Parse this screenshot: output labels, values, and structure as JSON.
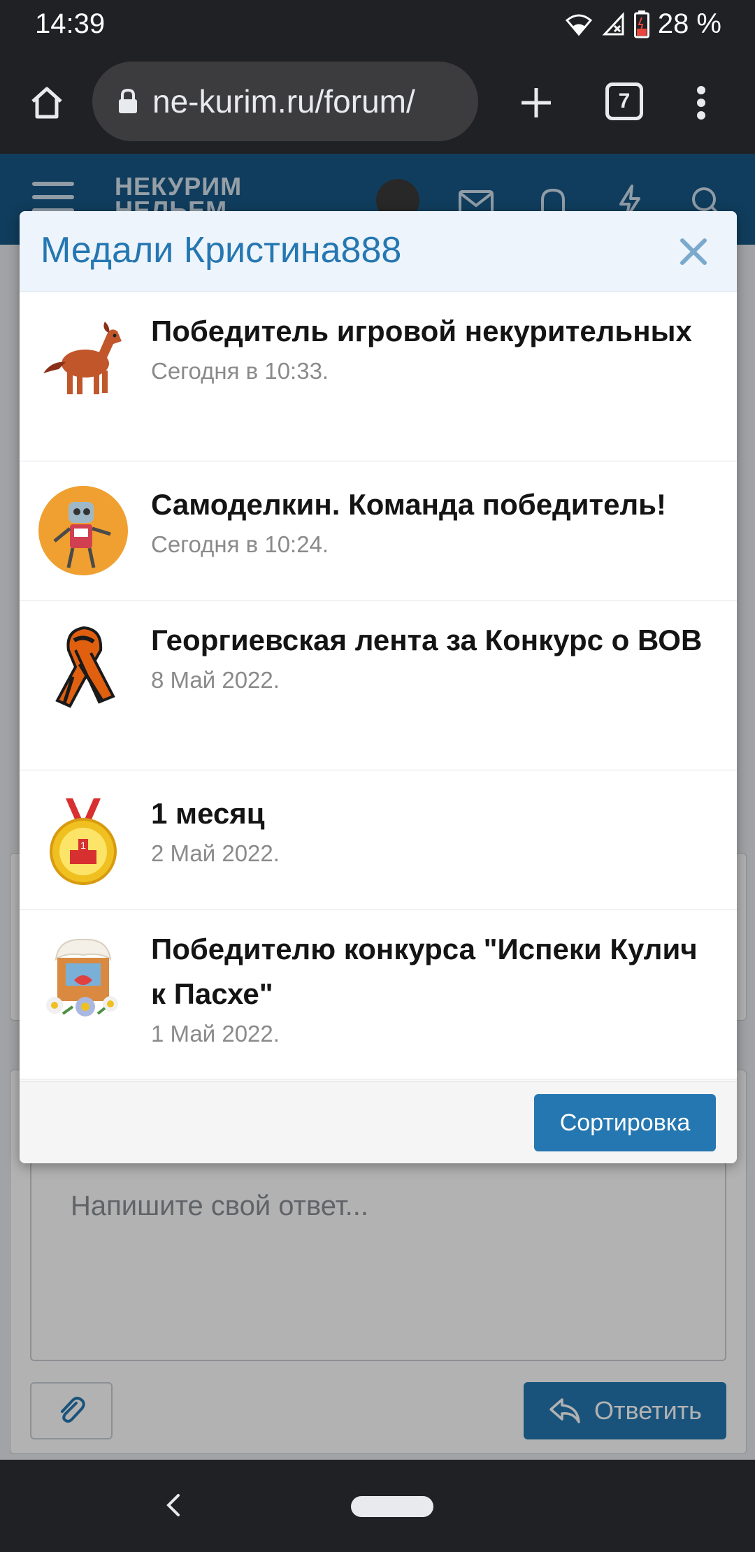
{
  "status_bar": {
    "time": "14:39",
    "battery": "28 %",
    "icons": [
      "wifi-icon",
      "signal-icon",
      "battery-icon"
    ]
  },
  "browser": {
    "url": "ne-kurim.ru/forum/",
    "tab_count": "7",
    "icons": [
      "home-icon",
      "lock-icon",
      "plus-icon",
      "more-vert-icon"
    ]
  },
  "site": {
    "logo": "НЕКУРИМ\nНЕЛЕМ",
    "header_icons": [
      "menu-icon",
      "avatar",
      "mail-icon",
      "bell-icon",
      "bolt-icon",
      "search-icon"
    ],
    "editor_placeholder": "Напишите свой ответ...",
    "reply_label": "Ответить"
  },
  "modal": {
    "title": "Медали Кристина888",
    "sort_label": "Сортировка",
    "medals": [
      {
        "title": "Победитель игровой некурительных",
        "date": "Сегодня в 10:33.",
        "icon": "horse-icon"
      },
      {
        "title": "Самоделкин. Команда победитель!",
        "date": "Сегодня в 10:24.",
        "icon": "robot-icon"
      },
      {
        "title": "Георгиевская лента за Конкурс о ВОВ",
        "date": "8 Май 2022.",
        "icon": "ribbon-icon"
      },
      {
        "title": "1 месяц",
        "date": "2 Май 2022.",
        "icon": "medal-icon"
      },
      {
        "title": "Победителю конкурса \"Испеки Кулич к Пасхе\"",
        "date": "1 Май 2022.",
        "icon": "easter-cake-icon"
      }
    ]
  },
  "colors": {
    "accent": "#2577b1",
    "header": "#185886",
    "system_bar": "#202124"
  }
}
